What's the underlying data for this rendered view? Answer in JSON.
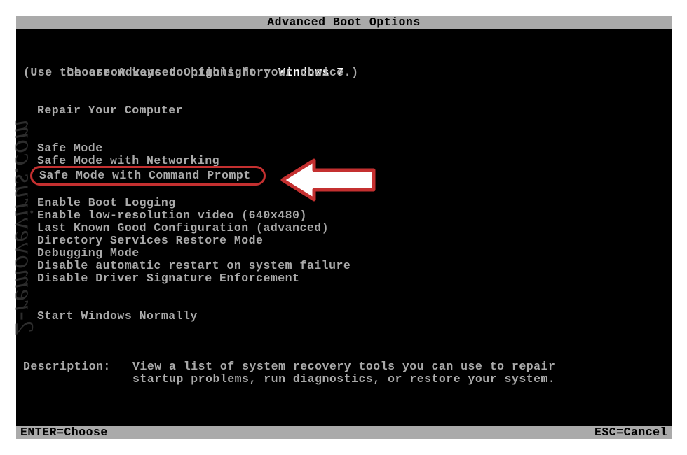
{
  "title": "Advanced Boot Options",
  "header": {
    "choose_prefix": "Choose Advanced Options for: ",
    "os_name": "Windows 7",
    "instructions": "(Use the arrow keys to highlight your choice.)"
  },
  "menu": {
    "repair": "Repair Your Computer",
    "safe_mode": "Safe Mode",
    "safe_mode_net": "Safe Mode with Networking",
    "safe_mode_cmd": "Safe Mode with Command Prompt",
    "boot_log": "Enable Boot Logging",
    "low_res": "Enable low-resolution video (640x480)",
    "lkgc": "Last Known Good Configuration (advanced)",
    "dsrm": "Directory Services Restore Mode",
    "debug": "Debugging Mode",
    "no_restart": "Disable automatic restart on system failure",
    "no_sig": "Disable Driver Signature Enforcement",
    "normal": "Start Windows Normally"
  },
  "description": {
    "label": "Description:",
    "line1": "View a list of system recovery tools you can use to repair",
    "line2": "startup problems, run diagnostics, or restore your system."
  },
  "footer": {
    "enter": "ENTER=Choose",
    "esc": "ESC=Cancel"
  },
  "watermark": "2-removevirus.com",
  "colors": {
    "highlight_border": "#c43030",
    "bg": "#000000",
    "fg": "#aaaaaa",
    "bar_bg": "#aaaaaa",
    "bar_fg": "#000000"
  }
}
